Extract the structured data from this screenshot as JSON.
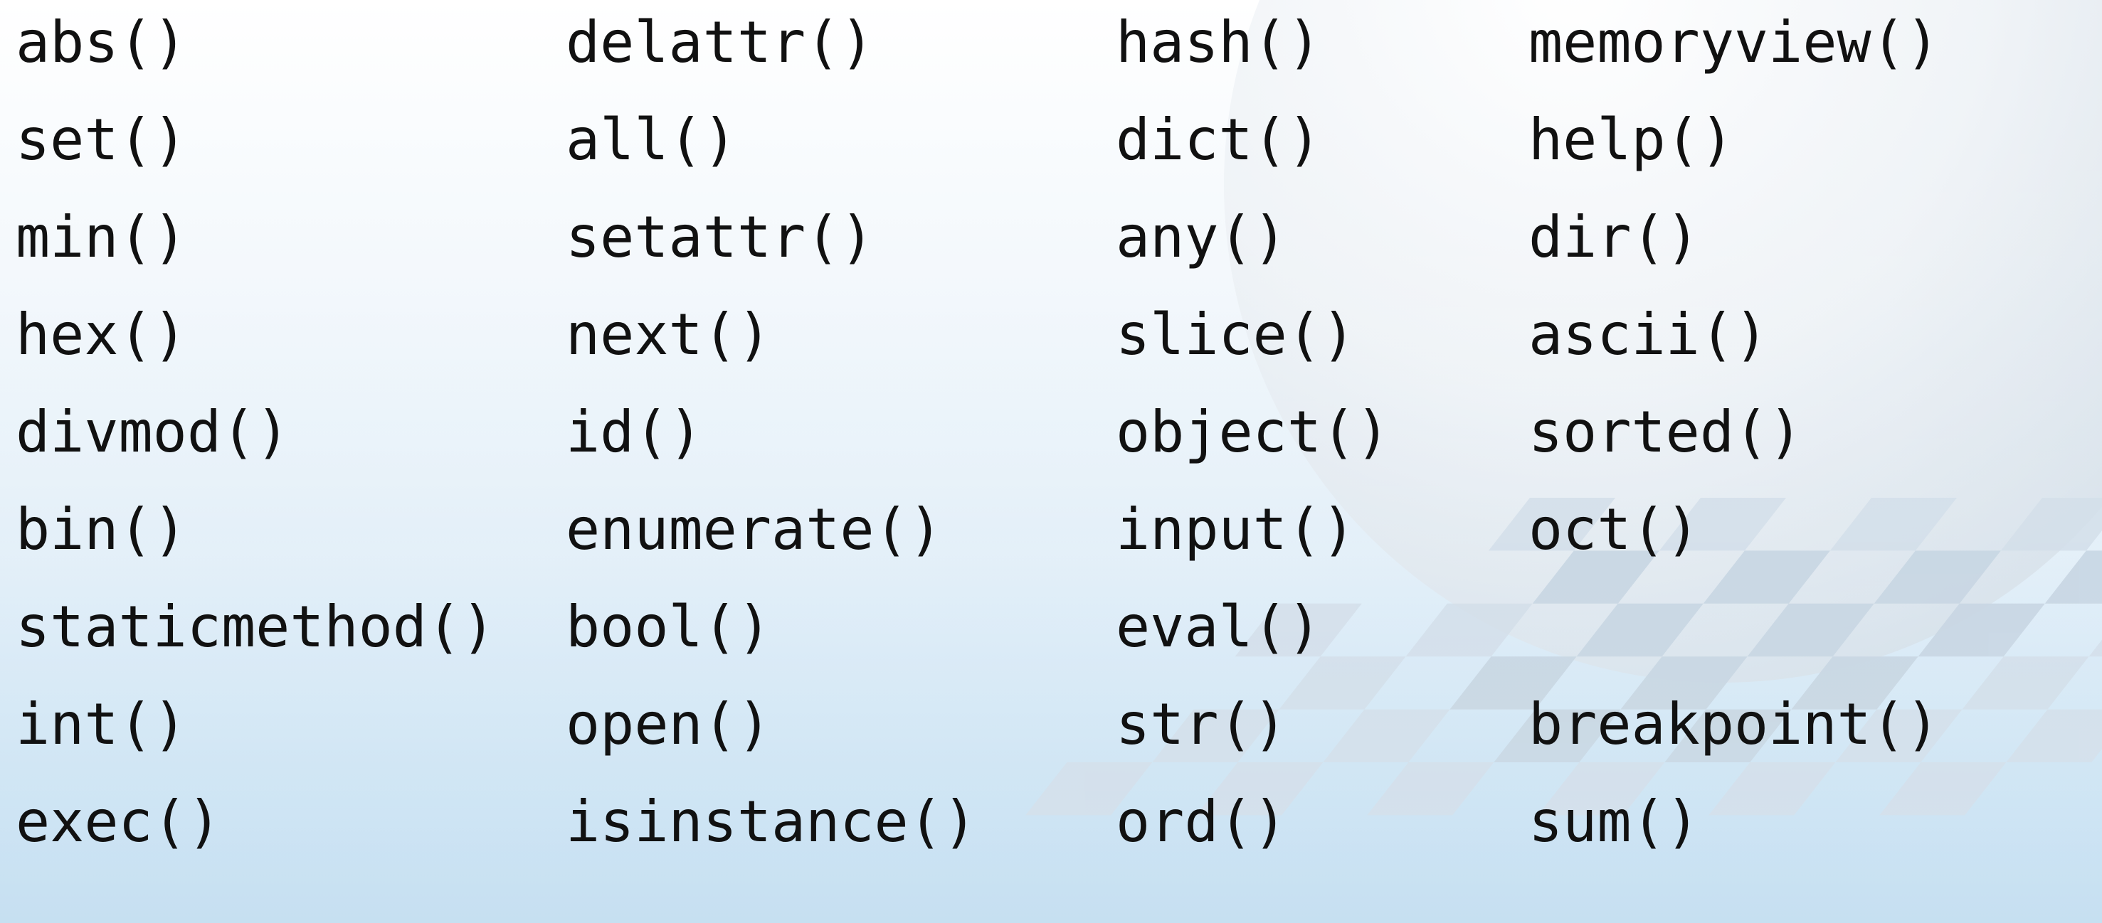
{
  "columns": [
    [
      "abs()",
      "set()",
      "min()",
      "hex()",
      "divmod()",
      "bin()",
      "staticmethod()",
      "int()",
      "exec()"
    ],
    [
      "delattr()",
      "all()",
      "setattr()",
      "next()",
      "id()",
      "enumerate()",
      "bool()",
      "open()",
      "isinstance()"
    ],
    [
      "hash()",
      "dict()",
      "any()",
      "slice()",
      "object()",
      "input()",
      "eval()",
      "str()",
      "ord()"
    ],
    [
      "memoryview()",
      "help()",
      "dir()",
      "ascii()",
      "sorted()",
      "oct()",
      "",
      "breakpoint()",
      "sum()"
    ]
  ],
  "colors": {
    "text": "#111111",
    "background_top": "#ffffff",
    "background_bottom": "#bcdaef",
    "tile_light": "#dbe6ef",
    "tile_dark": "#c7d6e3"
  }
}
